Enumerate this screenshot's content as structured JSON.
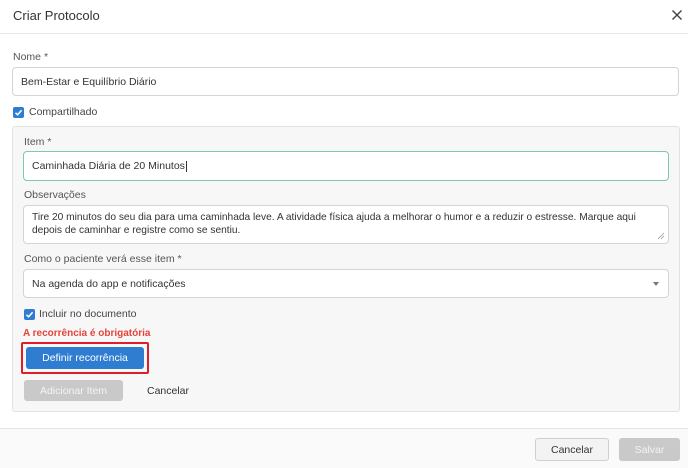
{
  "dialog": {
    "title": "Criar Protocolo",
    "close_icon": "close-icon"
  },
  "form": {
    "nome_label": "Nome",
    "required_mark": "*",
    "nome_value": "Bem-Estar e Equilíbrio Diário",
    "compartilhado_label": "Compartilhado",
    "compartilhado_checked": true
  },
  "item": {
    "item_label": "Item",
    "item_value": "Caminhada Diária de 20 Minutos",
    "observacoes_label": "Observações",
    "observacoes_value": "Tire 20 minutos do seu dia para uma caminhada leve. A atividade física ajuda a melhorar o humor e a reduzir o estresse. Marque aqui depois de caminhar e registre como se sentiu.",
    "visibility_label": "Como o paciente verá esse item",
    "visibility_value": "Na agenda do app e notificações",
    "incluir_label": "Incluir no documento",
    "incluir_checked": true,
    "error_text": "A recorrência é obrigatória",
    "definir_button": "Definir recorrência",
    "adicionar_button": "Adicionar Item",
    "cancelar_link": "Cancelar"
  },
  "footer": {
    "cancelar_button": "Cancelar",
    "salvar_button": "Salvar"
  },
  "colors": {
    "primary": "#2f7dd1",
    "error": "#e5443a",
    "highlight": "#e01e2a",
    "focus_border": "#7fc6b8"
  }
}
